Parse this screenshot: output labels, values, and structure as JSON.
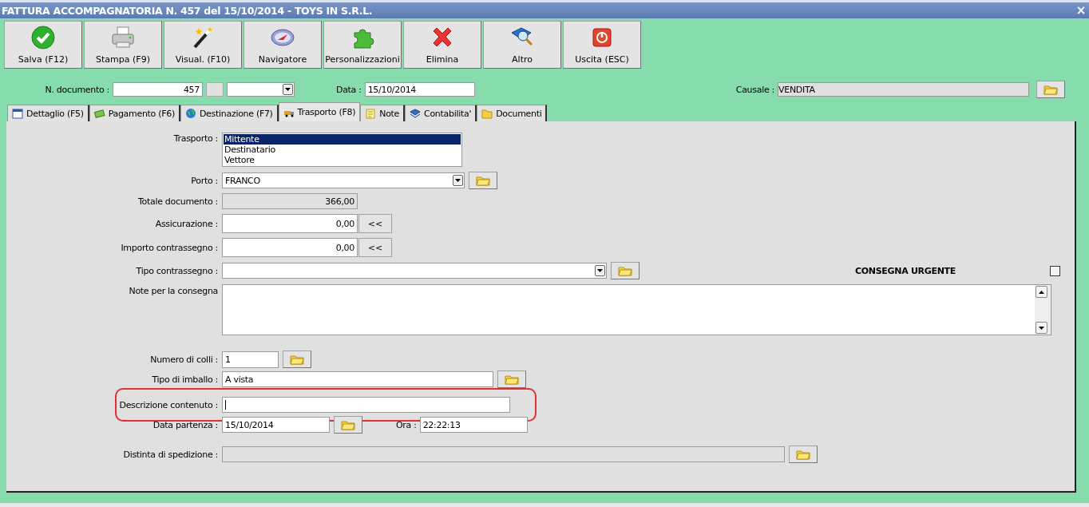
{
  "window": {
    "title": "FATTURA ACCOMPAGNATORIA N. 457 del 15/10/2014 - TOYS IN S.R.L.",
    "close": "×"
  },
  "toolbar": [
    {
      "label": "Salva (F12)"
    },
    {
      "label": "Stampa (F9)"
    },
    {
      "label": "Visual. (F10)"
    },
    {
      "label": "Navigatore"
    },
    {
      "label": "Personalizzazioni"
    },
    {
      "label": "Elimina"
    },
    {
      "label": "Altro"
    },
    {
      "label": "Uscita (ESC)"
    }
  ],
  "header": {
    "doc_label": "N. documento :",
    "doc_number": "457",
    "date_label": "Data :",
    "date": "15/10/2014",
    "causale_label": "Causale :",
    "causale": "VENDITA"
  },
  "tabs": [
    {
      "label": "Dettaglio (F5)",
      "selected": false
    },
    {
      "label": "Pagamento (F6)",
      "selected": false
    },
    {
      "label": "Destinazione (F7)",
      "selected": false
    },
    {
      "label": "Trasporto (F8)",
      "selected": true
    },
    {
      "label": "Note",
      "selected": false
    },
    {
      "label": "Contabilita'",
      "selected": false
    },
    {
      "label": "Documenti",
      "selected": false
    }
  ],
  "transport": {
    "trasporto": {
      "label": "Trasporto :",
      "options": [
        {
          "label": "Mittente",
          "selected": true
        },
        {
          "label": "Destinatario",
          "selected": false
        },
        {
          "label": "Vettore",
          "selected": false
        }
      ]
    },
    "porto": {
      "label": "Porto :",
      "value": "FRANCO"
    },
    "totale": {
      "label": "Totale documento :",
      "value": "366,00"
    },
    "assicurazione": {
      "label": "Assicurazione :",
      "value": "0,00",
      "button": "<<"
    },
    "importo": {
      "label": "Importo contrassegno :",
      "value": "0,00",
      "button": "<<"
    },
    "tipo_contrassegno": {
      "label": "Tipo contrassegno :"
    },
    "consegna_urgente": {
      "label": "CONSEGNA URGENTE",
      "checked": false
    },
    "note": {
      "label": "Note per la consegna"
    },
    "colli": {
      "label": "Numero di colli :",
      "value": "1"
    },
    "imballo": {
      "label": "Tipo di imballo :",
      "value": "A vista"
    },
    "descrizione": {
      "label": "Descrizione contenuto :",
      "highlighted": true
    },
    "partenza": {
      "label": "Data partenza :",
      "value": "15/10/2014",
      "time_label": "Ora :",
      "time": "22:22:13"
    },
    "distinta": {
      "label": "Distinta di spedizione :"
    }
  }
}
